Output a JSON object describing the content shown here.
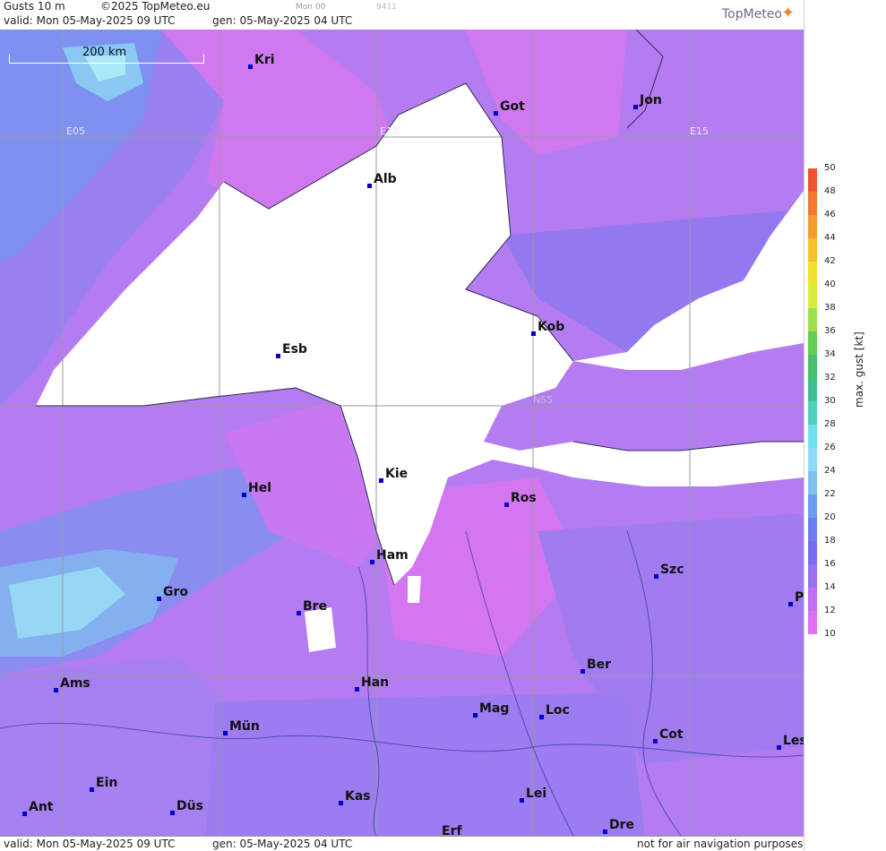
{
  "header": {
    "product": "Gusts 10 m",
    "copyright": "©2025 TopMeteo.eu",
    "valid": "valid:  Mon  05-May-2025  09 UTC",
    "gen": "gen: 05-May-2025 04 UTC",
    "ref": "Mon 00",
    "code": "9411",
    "logo": "TopMeteo"
  },
  "footer": {
    "valid": "valid:  Mon  05-May-2025  09 UTC",
    "gen": "gen: 05-May-2025 04 UTC",
    "note": "not for air navigation purposes"
  },
  "scale": {
    "label": "200 km"
  },
  "grid_labels": [
    {
      "id": "e05",
      "text": "E05"
    },
    {
      "id": "e10",
      "text": "E10"
    },
    {
      "id": "e15",
      "text": "E15"
    },
    {
      "id": "n55",
      "text": "N55"
    }
  ],
  "cities": [
    {
      "id": "kri",
      "name": "Kri"
    },
    {
      "id": "got",
      "name": "Got"
    },
    {
      "id": "jon",
      "name": "Jon"
    },
    {
      "id": "alb",
      "name": "Alb"
    },
    {
      "id": "esb",
      "name": "Esb"
    },
    {
      "id": "kob",
      "name": "Kob"
    },
    {
      "id": "kie",
      "name": "Kie"
    },
    {
      "id": "hel",
      "name": "Hel"
    },
    {
      "id": "ros",
      "name": "Ros"
    },
    {
      "id": "ham",
      "name": "Ham"
    },
    {
      "id": "szc",
      "name": "Szc"
    },
    {
      "id": "gro",
      "name": "Gro"
    },
    {
      "id": "bre",
      "name": "Bre"
    },
    {
      "id": "p",
      "name": "P"
    },
    {
      "id": "ber",
      "name": "Ber"
    },
    {
      "id": "ams",
      "name": "Ams"
    },
    {
      "id": "han",
      "name": "Han"
    },
    {
      "id": "mag",
      "name": "Mag"
    },
    {
      "id": "loc",
      "name": "Loc"
    },
    {
      "id": "mun",
      "name": "Mün"
    },
    {
      "id": "cot",
      "name": "Cot"
    },
    {
      "id": "les",
      "name": "Les"
    },
    {
      "id": "ein",
      "name": "Ein"
    },
    {
      "id": "kas",
      "name": "Kas"
    },
    {
      "id": "lei",
      "name": "Lei"
    },
    {
      "id": "ant",
      "name": "Ant"
    },
    {
      "id": "dus",
      "name": "Düs"
    },
    {
      "id": "dre",
      "name": "Dre"
    },
    {
      "id": "erf",
      "name": "Erf"
    }
  ],
  "legend": {
    "title": "max. gust [kt]",
    "labels": [
      "50",
      "48",
      "46",
      "44",
      "42",
      "40",
      "38",
      "36",
      "34",
      "32",
      "30",
      "28",
      "26",
      "24",
      "22",
      "20",
      "18",
      "16",
      "14",
      "12",
      "10"
    ],
    "colors": [
      "#ee5533",
      "#f07a33",
      "#f49a30",
      "#f6c030",
      "#f0e030",
      "#d6ec40",
      "#9ee050",
      "#66cc55",
      "#48c070",
      "#40c090",
      "#50d0c0",
      "#70e0f0",
      "#90d8f8",
      "#80c0f0",
      "#6a9cf0",
      "#6a80f0",
      "#7a6cf0",
      "#9a70f0",
      "#c070f0",
      "#e070f0"
    ]
  }
}
